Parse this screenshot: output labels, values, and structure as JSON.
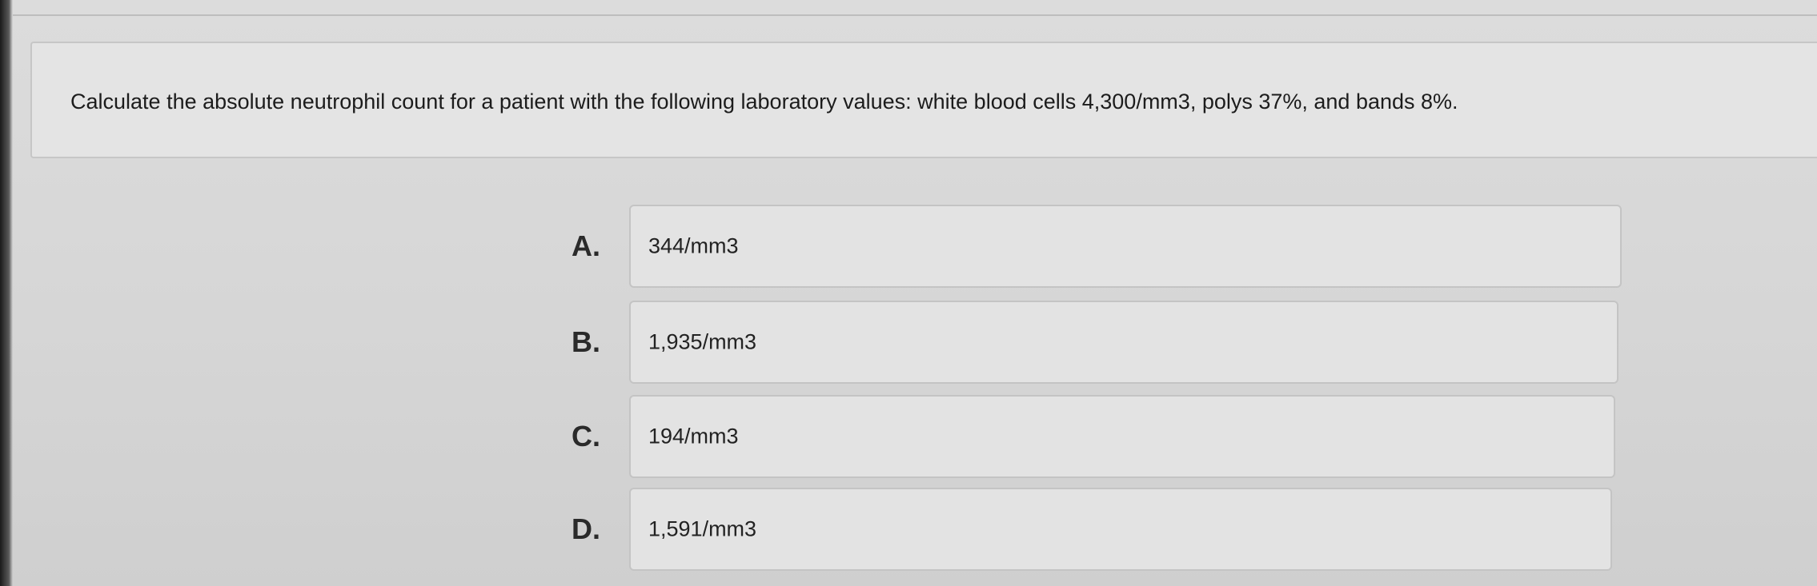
{
  "question": {
    "text": "Calculate the absolute neutrophil count for a patient with the following laboratory values: white blood cells 4,300/mm3, polys 37%, and bands 8%."
  },
  "options": [
    {
      "letter": "A.",
      "text": "344/mm3"
    },
    {
      "letter": "B.",
      "text": "1,935/mm3"
    },
    {
      "letter": "C.",
      "text": "194/mm3"
    },
    {
      "letter": "D.",
      "text": "1,591/mm3"
    }
  ]
}
